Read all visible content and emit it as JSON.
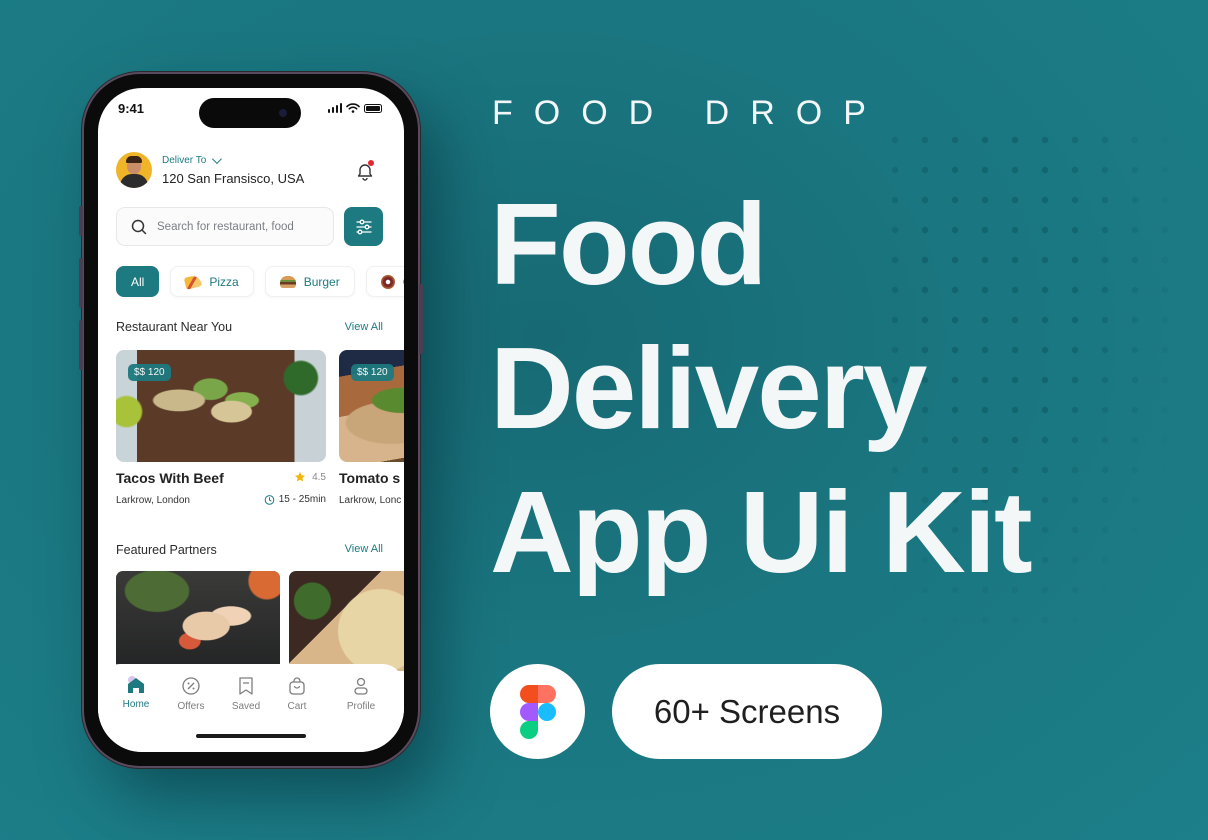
{
  "colors": {
    "accent": "#1d7a80",
    "background": "#1a7680",
    "notification_dot": "#e5262b",
    "star": "#f5b40a"
  },
  "phone": {
    "status_bar": {
      "time": "9:41",
      "icons": [
        "signal-icon",
        "wifi-icon",
        "battery-icon"
      ]
    },
    "header": {
      "deliver_to_label": "Deliver To",
      "address": "120 San Fransisco, USA",
      "notification_icon": "bell-icon"
    },
    "search": {
      "placeholder": "Search for restaurant, food",
      "value": ""
    },
    "categories": [
      {
        "label": "All",
        "active": true
      },
      {
        "label": "Pizza",
        "icon": "pizza-icon"
      },
      {
        "label": "Burger",
        "icon": "burger-icon"
      },
      {
        "label": "C",
        "icon": "donut-icon"
      }
    ],
    "nearby": {
      "title": "Restaurant Near You",
      "view_all": "View All",
      "cards": [
        {
          "price": "$$ 120",
          "name": "Tacos With Beef",
          "rating": "4.5",
          "location": "Larkrow, London",
          "time": "15 - 25min"
        },
        {
          "price": "$$ 120",
          "name": "Tomato s",
          "location": "Larkrow, Lonc"
        }
      ]
    },
    "featured": {
      "title": "Featured Partners",
      "view_all": "View All"
    },
    "tabbar": [
      {
        "label": "Home",
        "icon": "home-icon",
        "active": true
      },
      {
        "label": "Offers",
        "icon": "discount-icon"
      },
      {
        "label": "Saved",
        "icon": "bookmark-icon"
      },
      {
        "label": "Cart",
        "icon": "bag-icon"
      },
      {
        "label": "Profile",
        "icon": "user-icon"
      }
    ]
  },
  "promo": {
    "brand": "FOOD DROP",
    "headline_lines": [
      "Food",
      "Delivery",
      "App Ui Kit"
    ],
    "badge": "60+ Screens",
    "tool_icon": "figma-icon"
  }
}
